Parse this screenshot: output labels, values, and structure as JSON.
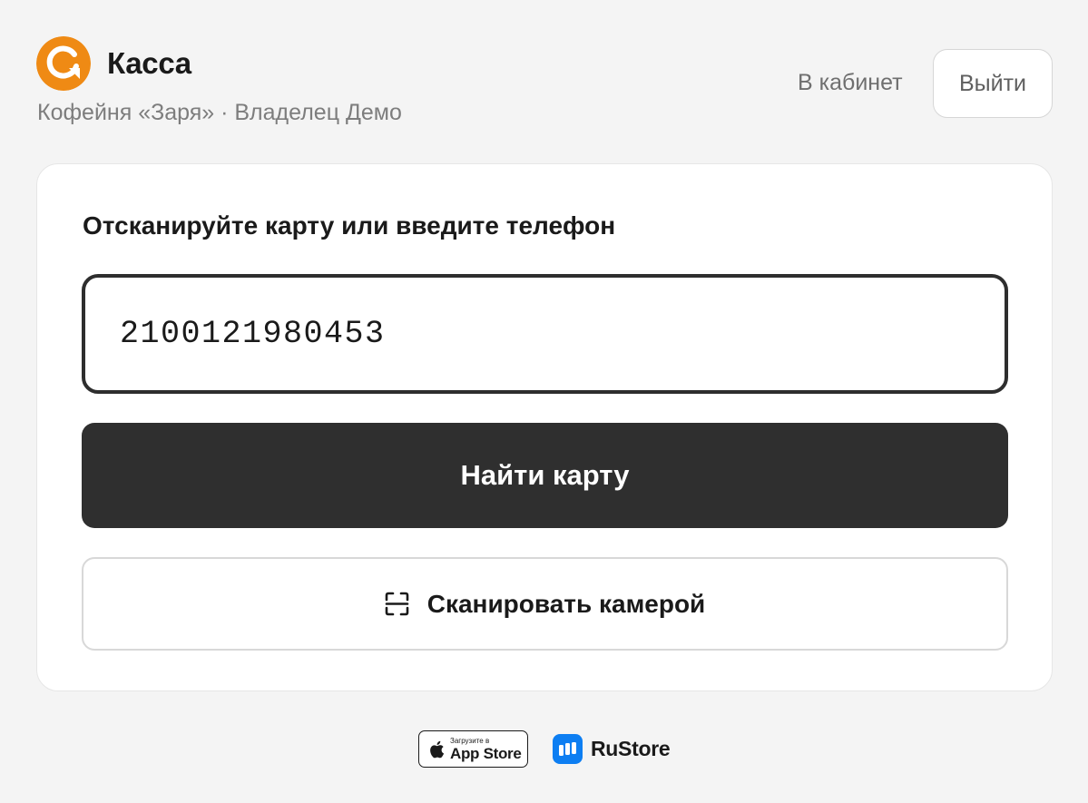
{
  "header": {
    "app_title": "Касса",
    "subtitle": "Кофейня «Заря» · Владелец Демо",
    "cabinet_link": "В кабинет",
    "logout_label": "Выйти",
    "logo_icon": "refresh-arrow-circle-icon",
    "brand_color": "#ef8a14"
  },
  "card_lookup": {
    "prompt": "Отсканируйте карту или введите телефон",
    "input_value": "2100121980453",
    "find_button_label": "Найти карту",
    "scan_button_label": "Сканировать камерой",
    "scan_icon": "scan-frame-icon",
    "primary_color": "#2f2f2f"
  },
  "stores": {
    "appstore_small": "Загрузите в",
    "appstore_big": "App Store",
    "appstore_icon": "apple-icon",
    "rustore_label": "RuStore",
    "rustore_icon": "rustore-icon",
    "rustore_color": "#0d7ef2"
  }
}
